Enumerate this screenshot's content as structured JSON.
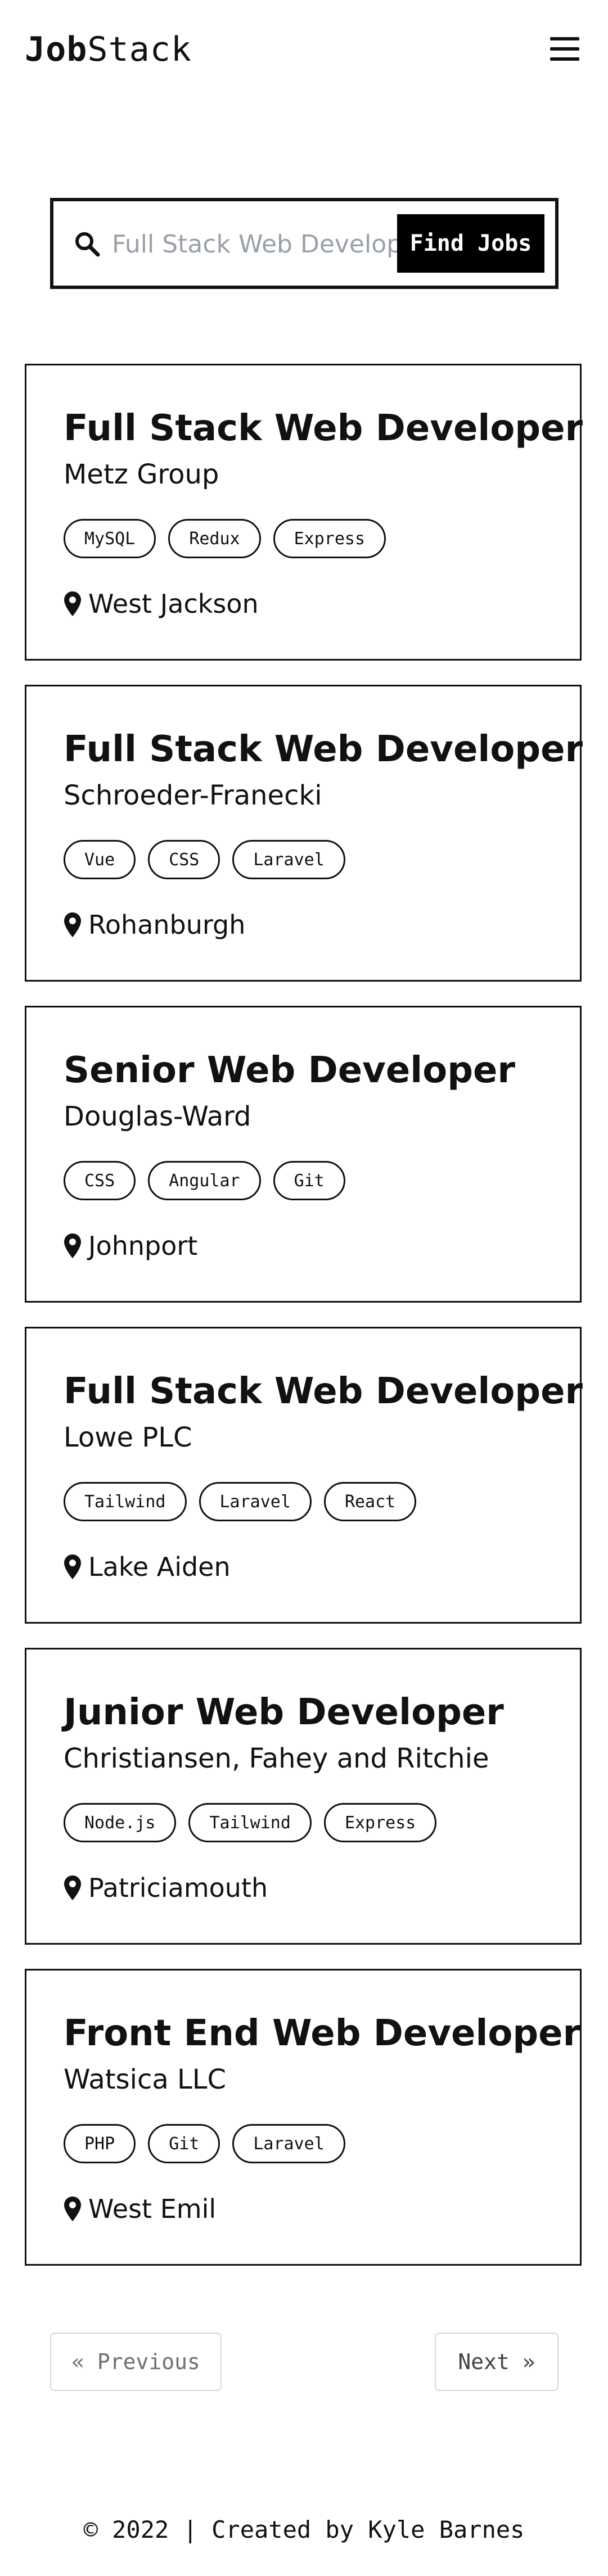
{
  "header": {
    "logo_bold": "Job",
    "logo_regular": "Stack"
  },
  "search": {
    "placeholder": "Full Stack Web Developer",
    "button_label": "Find Jobs"
  },
  "jobs": [
    {
      "title": "Full Stack Web Developer",
      "company": "Metz Group",
      "tags": [
        "MySQL",
        "Redux",
        "Express"
      ],
      "location": "West Jackson"
    },
    {
      "title": "Full Stack Web Developer",
      "company": "Schroeder-Franecki",
      "tags": [
        "Vue",
        "CSS",
        "Laravel"
      ],
      "location": "Rohanburgh"
    },
    {
      "title": "Senior Web Developer",
      "company": "Douglas-Ward",
      "tags": [
        "CSS",
        "Angular",
        "Git"
      ],
      "location": "Johnport"
    },
    {
      "title": "Full Stack Web Developer",
      "company": "Lowe PLC",
      "tags": [
        "Tailwind",
        "Laravel",
        "React"
      ],
      "location": "Lake Aiden"
    },
    {
      "title": "Junior Web Developer",
      "company": "Christiansen, Fahey and Ritchie",
      "tags": [
        "Node.js",
        "Tailwind",
        "Express"
      ],
      "location": "Patriciamouth"
    },
    {
      "title": "Front End Web Developer",
      "company": "Watsica LLC",
      "tags": [
        "PHP",
        "Git",
        "Laravel"
      ],
      "location": "West Emil"
    }
  ],
  "pagination": {
    "previous_label": "« Previous",
    "next_label": "Next »"
  },
  "footer": {
    "text": "© 2022 | Created by Kyle Barnes"
  }
}
